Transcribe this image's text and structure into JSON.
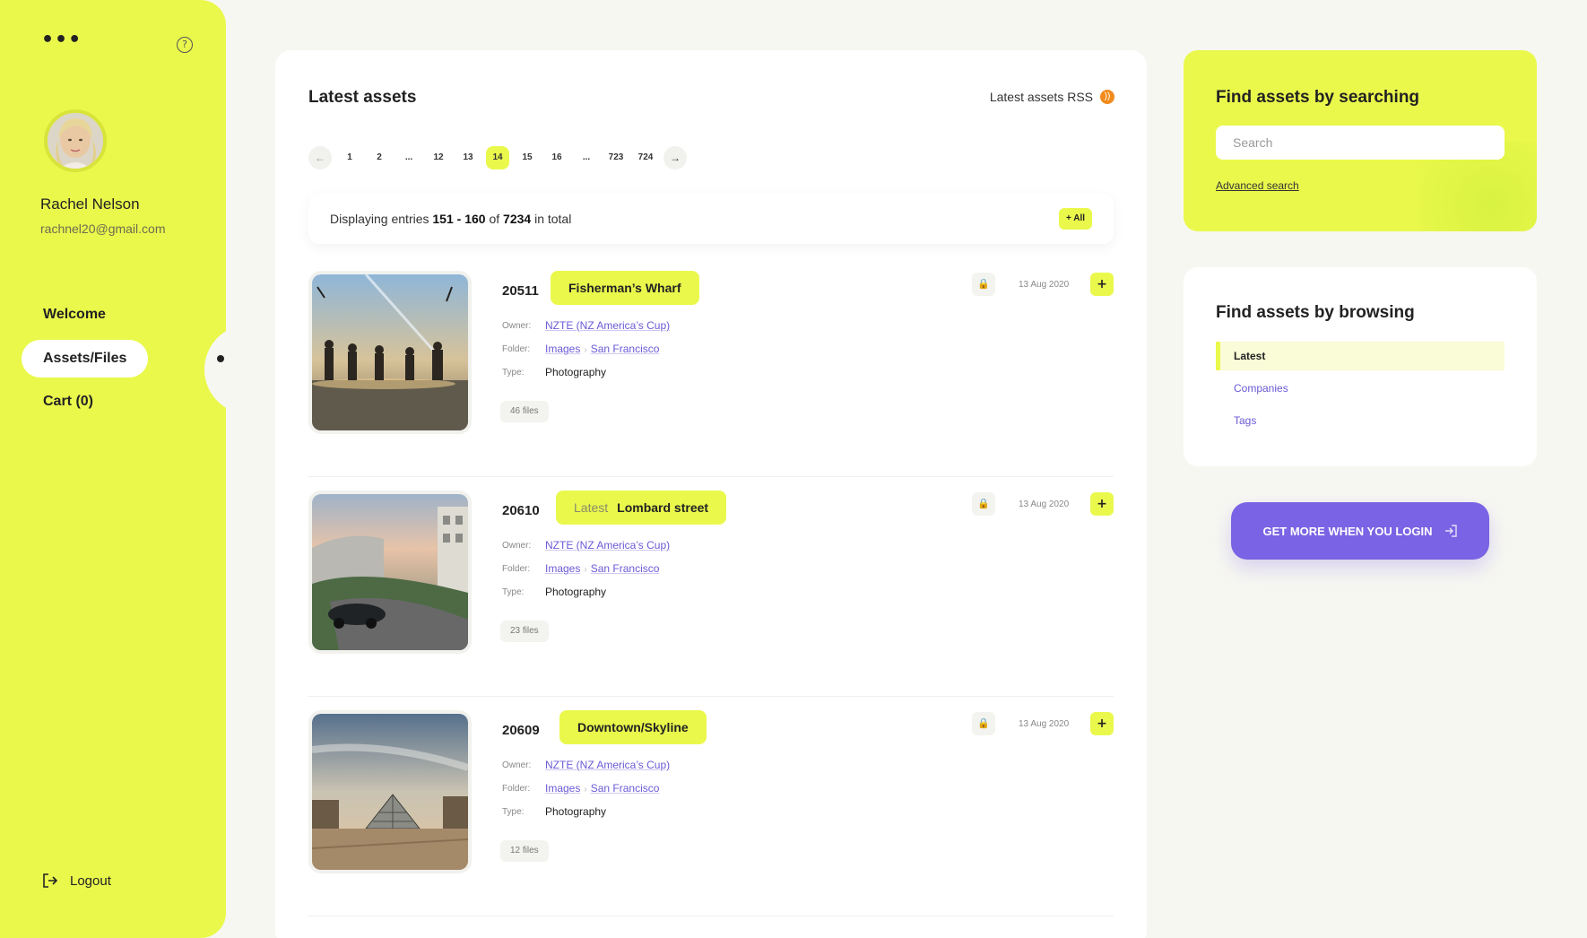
{
  "sidebar": {
    "user_name": "Rachel Nelson",
    "user_email": "rachnel20@gmail.com",
    "nav": [
      "Welcome",
      "Assets/Files",
      "Cart (0)"
    ],
    "active_nav": "Assets/Files",
    "logout_label": "Logout",
    "help_glyph": "?"
  },
  "main": {
    "title": "Latest assets",
    "rss_label": "Latest assets RSS",
    "pagination": {
      "prev": "←",
      "next": "→",
      "pages": [
        "1",
        "2",
        "...",
        "12",
        "13",
        "14",
        "15",
        "16",
        "...",
        "723",
        "724"
      ],
      "current": "14"
    },
    "entries": {
      "prefix": "Displaying entries",
      "range": "151 - 160",
      "of": "of",
      "total": "7234",
      "suffix": "in total",
      "all_button": "+ All"
    },
    "labels": {
      "owner": "Owner:",
      "folder": "Folder:",
      "type": "Type:"
    },
    "assets": [
      {
        "id": "20511",
        "tag_prefix": "",
        "title": "Fisherman’s Wharf",
        "owner": "NZTE (NZ America’s Cup)",
        "folder": [
          "Images",
          "San Francisco"
        ],
        "type": "Photography",
        "files": "46 files",
        "date": "13 Aug 2020"
      },
      {
        "id": "20610",
        "tag_prefix": "Latest",
        "title": "Lombard street",
        "owner": "NZTE (NZ America’s Cup)",
        "folder": [
          "Images",
          "San Francisco"
        ],
        "type": "Photography",
        "files": "23 files",
        "date": "13 Aug 2020"
      },
      {
        "id": "20609",
        "tag_prefix": "",
        "title": "Downtown/Skyline",
        "owner": "NZTE (NZ America’s Cup)",
        "folder": [
          "Images",
          "San Francisco"
        ],
        "type": "Photography",
        "files": "12 files",
        "date": "13 Aug 2020"
      }
    ]
  },
  "search_card": {
    "title": "Find assets by searching",
    "placeholder": "Search",
    "advanced_link": "Advanced search"
  },
  "browse_card": {
    "title": "Find assets by browsing",
    "items": [
      "Latest",
      "Companies",
      "Tags"
    ],
    "active": "Latest"
  },
  "login_button": "GET MORE WHEN YOU LOGIN",
  "colors": {
    "accent": "#eaf84c",
    "purple": "#7a63e4",
    "link": "#6a5ad6",
    "background": "#f7f7f2"
  },
  "icons": [
    "more-dots-icon",
    "help-icon",
    "logout-icon",
    "rss-icon",
    "lock-icon",
    "plus-icon",
    "login-arrow-icon",
    "folder-chevron-icon"
  ]
}
